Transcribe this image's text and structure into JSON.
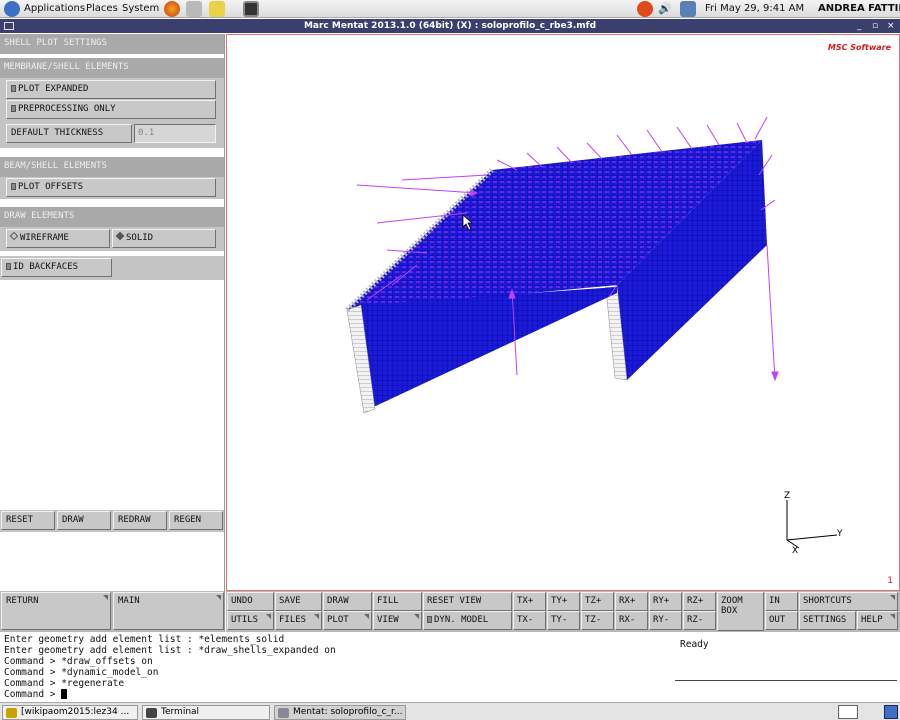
{
  "top_panel": {
    "applications": "Applications",
    "places": "Places",
    "system": "System",
    "datetime": "Fri May 29,  9:41 AM",
    "user": "ANDREA FATTINI"
  },
  "window": {
    "title": "Marc Mentat 2013.1.0 (64bit) (X) : soloprofilo_c_rbe3.mfd",
    "minimize": "_",
    "maximize": "▫",
    "close": "×"
  },
  "left_panel": {
    "title": "SHELL PLOT SETTINGS",
    "membrane_header": "MEMBRANE/SHELL ELEMENTS",
    "plot_expanded": "PLOT EXPANDED",
    "preprocessing_only": "PREPROCESSING ONLY",
    "default_thickness": "DEFAULT THICKNESS",
    "default_thickness_value": "0.1",
    "beam_header": "BEAM/SHELL ELEMENTS",
    "plot_offsets": "PLOT OFFSETS",
    "draw_header": "DRAW ELEMENTS",
    "wireframe": "WIREFRAME",
    "solid": "SOLID",
    "id_backfaces": "ID BACKFACES",
    "reset": "RESET",
    "draw": "DRAW",
    "redraw": "REDRAW",
    "regen": "REGEN",
    "return": "RETURN",
    "main": "MAIN"
  },
  "viewport": {
    "brand": "MSC Software",
    "window_number": "1",
    "axis_x": "X",
    "axis_y": "Y",
    "axis_z": "Z"
  },
  "toolbar": {
    "undo": "UNDO",
    "save": "SAVE",
    "draw": "DRAW",
    "fill": "FILL",
    "reset_view": "RESET VIEW",
    "tx_plus": "TX+",
    "ty_plus": "TY+",
    "tz_plus": "TZ+",
    "rx_plus": "RX+",
    "ry_plus": "RY+",
    "rz_plus": "RZ+",
    "zoom_box_1": "ZOOM",
    "zoom_box_2": "BOX",
    "in": "IN",
    "shortcuts": "SHORTCUTS",
    "utils": "UTILS",
    "files": "FILES",
    "plot": "PLOT",
    "view": "VIEW",
    "dyn_model": "DYN. MODEL",
    "tx_minus": "TX-",
    "ty_minus": "TY-",
    "tz_minus": "TZ-",
    "rx_minus": "RX-",
    "ry_minus": "RY-",
    "rz_minus": "RZ-",
    "out": "OUT",
    "settings": "SETTINGS",
    "help": "HELP"
  },
  "console": {
    "lines": [
      "Enter geometry add element list : *elements_solid",
      "Enter geometry add element list : *draw_shells_expanded on",
      "Command > *draw_offsets on",
      "Command > *dynamic_model_on",
      "Command > *regenerate",
      "Command > "
    ],
    "status": "Ready"
  },
  "taskbar": {
    "items": [
      "[wikipaom2015:lez34 ...",
      "Terminal",
      "Mentat: soloprofilo_c_r..."
    ]
  },
  "colors": {
    "title_bar": "#3a3f6e",
    "mesh_blue": "#1a1ad8",
    "load_arrows": "#c040ff",
    "viewport_border": "#e07070"
  }
}
